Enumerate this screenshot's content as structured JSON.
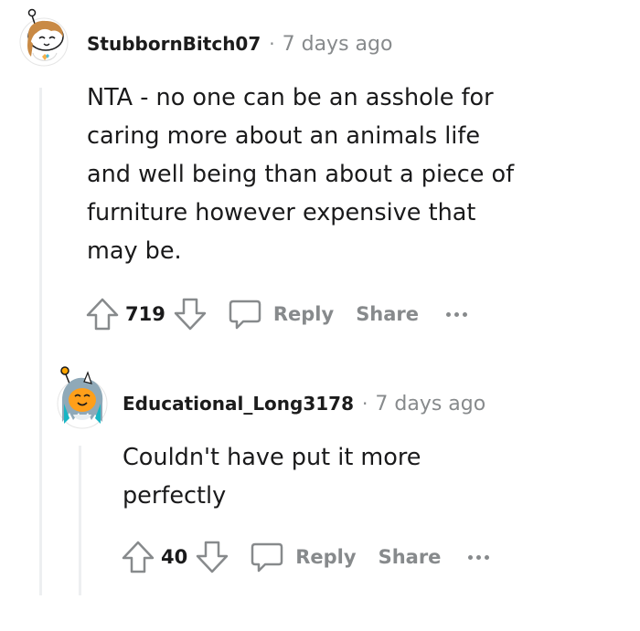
{
  "comments": [
    {
      "author": "StubbornBitch07",
      "separator": "·",
      "time": "7 days ago",
      "body_lines": [
        "NTA - no one can be an asshole for",
        "caring more about an animals life",
        "and well being than about a piece of",
        "furniture however expensive that",
        "may be."
      ],
      "votes": "719",
      "reply_label": "Reply",
      "share_label": "Share"
    },
    {
      "author": "Educational_Long3178",
      "separator": "·",
      "time": "7 days ago",
      "body_lines": [
        "Couldn't have put it more",
        "perfectly"
      ],
      "votes": "40",
      "reply_label": "Reply",
      "share_label": "Share"
    }
  ],
  "colors": {
    "muted": "#878a8c",
    "text": "#1a1a1b",
    "thread_line": "#edeff1"
  }
}
